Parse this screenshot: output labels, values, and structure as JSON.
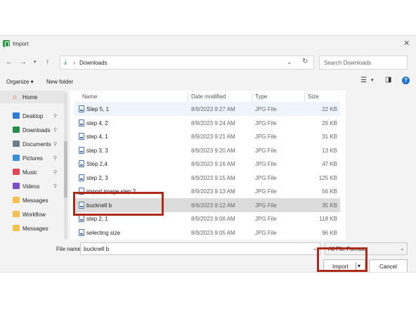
{
  "window": {
    "title": "Import"
  },
  "nav": {
    "path": "Downloads",
    "search_placeholder": "Search Downloads"
  },
  "toolbar": {
    "organize": "Organize ▾",
    "new_folder": "New folder"
  },
  "sidebar": {
    "home": "Home",
    "items": [
      {
        "label": "Desktop",
        "icon": "desktop-icon",
        "color": "#2f7bd6"
      },
      {
        "label": "Downloads",
        "icon": "downloads-icon",
        "color": "#2a8b4a"
      },
      {
        "label": "Documents",
        "icon": "documents-icon",
        "color": "#6f7d8c"
      },
      {
        "label": "Pictures",
        "icon": "pictures-icon",
        "color": "#3a8fd9"
      },
      {
        "label": "Music",
        "icon": "music-icon",
        "color": "#e0445b"
      },
      {
        "label": "Videos",
        "icon": "videos-icon",
        "color": "#7a4fc5"
      },
      {
        "label": "Messages",
        "icon": "folder-icon",
        "color": "#f2c14e"
      },
      {
        "label": "Workflow",
        "icon": "folder-icon",
        "color": "#f2c14e"
      },
      {
        "label": "Messages",
        "icon": "folder-icon",
        "color": "#f2c14e"
      }
    ]
  },
  "columns": {
    "name": "Name",
    "date": "Date modified",
    "type": "Type",
    "size": "Size"
  },
  "files": [
    {
      "name": "Step 5, 1",
      "date": "8/9/2023 9:27 AM",
      "type": "JPG File",
      "size": "22 KB"
    },
    {
      "name": "step 4, 2",
      "date": "8/9/2023 9:24 AM",
      "type": "JPG File",
      "size": "26 KB"
    },
    {
      "name": "step 4, 1",
      "date": "8/9/2023 9:21 AM",
      "type": "JPG File",
      "size": "31 KB"
    },
    {
      "name": "step 3, 3",
      "date": "8/9/2023 9:20 AM",
      "type": "JPG File",
      "size": "13 KB"
    },
    {
      "name": "Step 2,4",
      "date": "8/9/2023 9:16 AM",
      "type": "JPG File",
      "size": "47 KB"
    },
    {
      "name": "step 2, 3",
      "date": "8/9/2023 9:15 AM",
      "type": "JPG File",
      "size": "125 KB"
    },
    {
      "name": "import image step 2",
      "date": "8/9/2023 9:13 AM",
      "type": "JPG File",
      "size": "56 KB"
    },
    {
      "name": "bucknell b",
      "date": "8/9/2023 9:12 AM",
      "type": "JPG File",
      "size": "35 KB"
    },
    {
      "name": "step 2, 1",
      "date": "8/9/2023 9:06 AM",
      "type": "JPG File",
      "size": "118 KB"
    },
    {
      "name": "selecting size",
      "date": "8/9/2023 9:05 AM",
      "type": "JPG File",
      "size": "96 KB"
    }
  ],
  "footer": {
    "file_name_label": "File name:",
    "file_name_value": "bucknell b",
    "format": "All File Formats",
    "import": "Import",
    "cancel": "Cancel"
  },
  "colors": {
    "highlight": "#b02a1c",
    "selected_row": "#dcdcdc",
    "accent": "#1a73c8"
  }
}
